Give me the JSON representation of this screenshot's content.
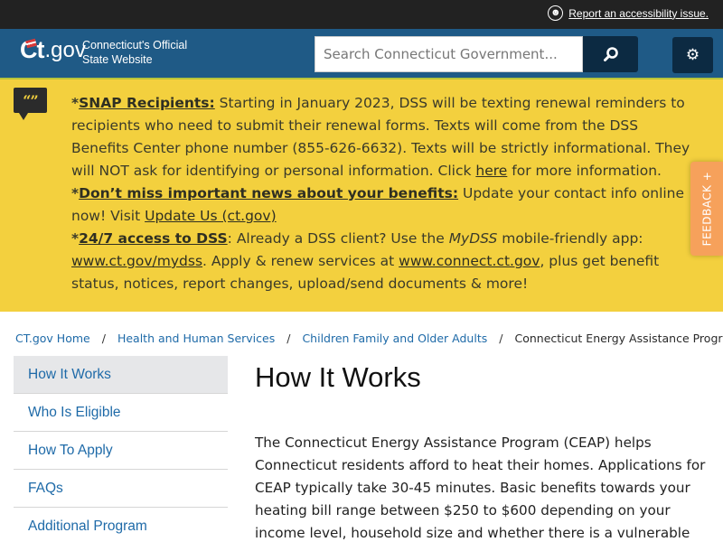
{
  "topbar": {
    "accessibility_icon": "accessibility-icon",
    "accessibility_link": "Report an accessibility issue."
  },
  "header": {
    "logo_ct": "Ct",
    "logo_gov": ".gov",
    "site_name_line1": "Connecticut's Official",
    "site_name_line2": "State Website",
    "search_placeholder": "Search Connecticut Government...",
    "search_icon": "search-icon",
    "settings_icon": "gear-icon"
  },
  "alert": {
    "icon": "quote-bubble-icon",
    "icon_glyph": "“”",
    "p1": {
      "prefix": "*",
      "title": "SNAP Recipients:",
      "text_before_link": " Starting in January 2023, DSS will be texting renewal reminders to recipients who need to submit their renewal forms. Texts will come from the DSS Benefits Center phone number (855-626-6632). Texts will be strictly informational. They will NOT ask for identifying or personal information. Click ",
      "link": "here",
      "text_after_link": " for more information."
    },
    "p2": {
      "prefix": "*",
      "title": "Don’t miss important news about your benefits:",
      "text": " Update your contact info online now! Visit ",
      "link": "Update Us (ct.gov)"
    },
    "p3": {
      "prefix": "*",
      "title": "24/7 access to DSS",
      "text1": ": Already a DSS client? Use the ",
      "italic": "MyDSS",
      "text2": " mobile-friendly app: ",
      "link1": "www.ct.gov/mydss",
      "text3": ". Apply & renew services at ",
      "link2": "www.connect.ct.gov",
      "text4": ", plus get benefit status, notices, report changes, upload/send documents & more!"
    }
  },
  "feedback": {
    "label": "FEEDBACK +"
  },
  "breadcrumb": {
    "items": [
      {
        "label": "CT.gov Home"
      },
      {
        "label": "Health and Human Services"
      },
      {
        "label": "Children Family and Older Adults"
      },
      {
        "label": "Connecticut Energy Assistance Program"
      }
    ],
    "separator": "/"
  },
  "sidenav": {
    "items": [
      {
        "label": "How It Works",
        "active": true
      },
      {
        "label": "Who Is Eligible"
      },
      {
        "label": "How To Apply"
      },
      {
        "label": "FAQs"
      },
      {
        "label": "Additional Program"
      }
    ]
  },
  "main": {
    "title": "How It Works",
    "body": "The Connecticut Energy Assistance Program (CEAP) helps Connecticut residents afford to heat their homes. Applications for CEAP typically take 30-45 minutes. Basic benefits towards your heating bill range between $250 to $600 depending on your income level, household size and whether there is a vulnerable"
  },
  "colors": {
    "topbar_bg": "#222222",
    "header_bg": "#1f5a86",
    "button_dark": "#0c2a42",
    "alert_bg": "#f3d03e",
    "feedback_bg": "#f6a15b",
    "link_blue": "#1e6aa8",
    "active_nav_bg": "#e6e7e9"
  }
}
